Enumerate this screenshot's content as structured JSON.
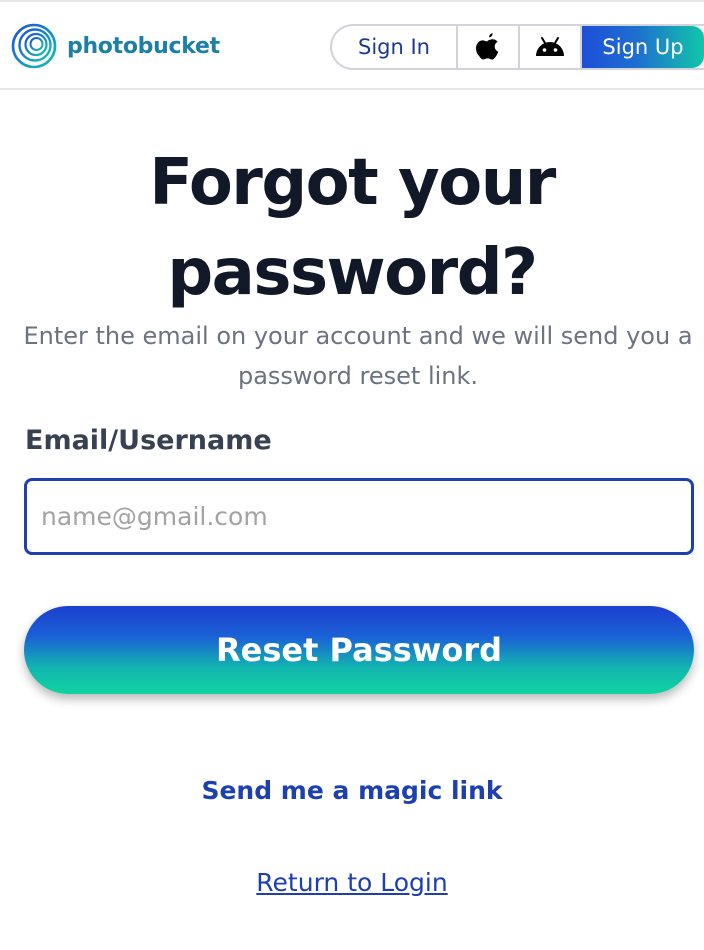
{
  "header": {
    "brand": "photobucket",
    "nav": {
      "signin_label": "Sign In",
      "apple_icon": "apple-icon",
      "android_icon": "android-icon",
      "signup_label": "Sign Up"
    }
  },
  "main": {
    "title": "Forgot your password?",
    "subtitle": "Enter the email on your account and we will send you a password reset link.",
    "email_label": "Email/Username",
    "email_placeholder": "name@gmail.com",
    "email_value": "",
    "reset_button_label": "Reset Password",
    "magic_link_label": "Send me a magic link",
    "return_link_label": "Return to Login"
  },
  "colors": {
    "brand_text": "#1d7fa7",
    "link": "#1e40af",
    "input_border": "#1e40af",
    "gradient_start": "#1d3fcf",
    "gradient_end": "#0fd3a0"
  }
}
